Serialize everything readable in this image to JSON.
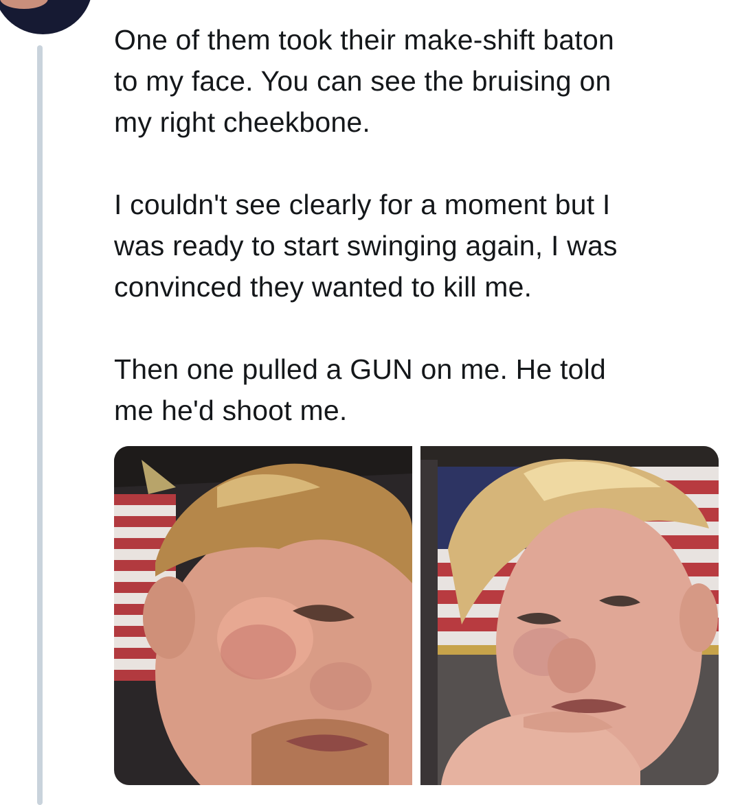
{
  "tweet": {
    "paragraphs": [
      "One of them took their make-shift baton\nto my face. You can see the bruising on\nmy right cheekbone.",
      "I couldn't see clearly for a moment but I\nwas ready to start swinging again, I was\nconvinced they wanted to kill me.",
      "Then one pulled a GUN on me. He told\nme he'd shoot me."
    ]
  },
  "media": {
    "photos": [
      {
        "name": "photo-left"
      },
      {
        "name": "photo-right"
      }
    ]
  }
}
